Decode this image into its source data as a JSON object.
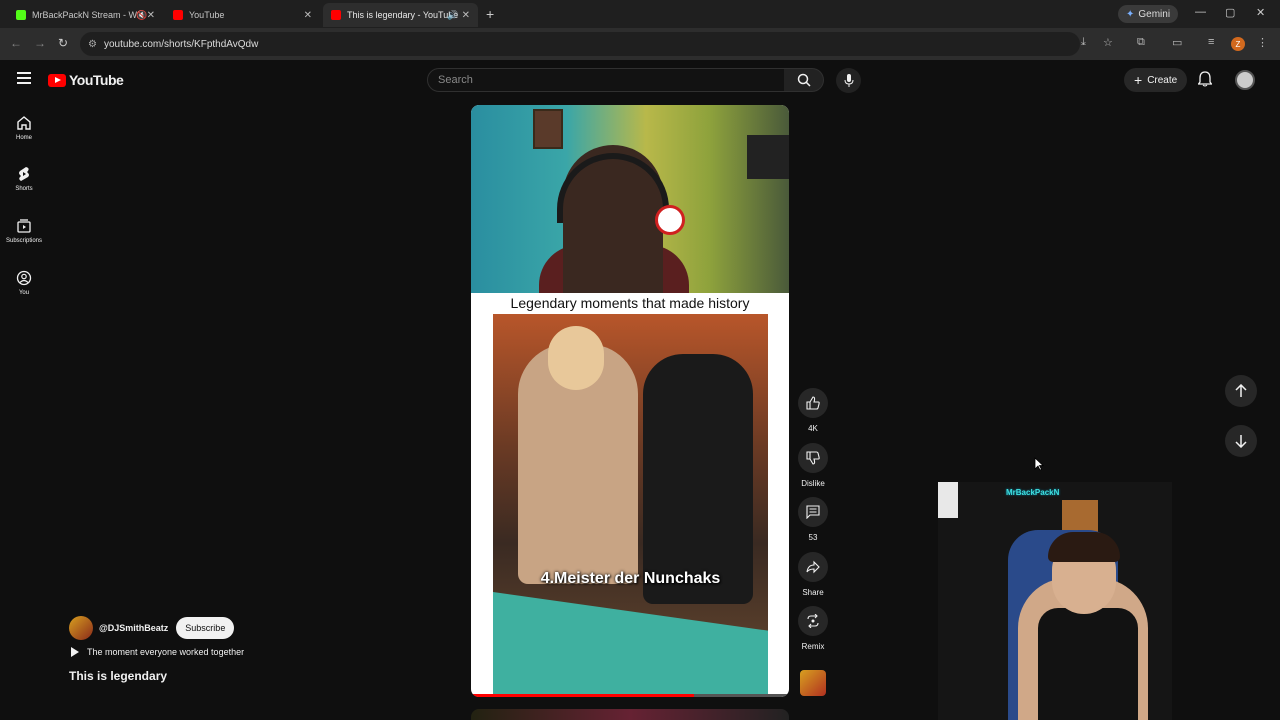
{
  "browser": {
    "tabs": [
      {
        "title": "MrBackPackN Stream - Wa",
        "favicon_color": "#53fc18"
      },
      {
        "title": "YouTube",
        "favicon_color": "#ff0000"
      },
      {
        "title": "This is legendary - YouTube",
        "favicon_color": "#ff0000",
        "active": true
      }
    ],
    "new_tab": "+",
    "gemini_label": "Gemini",
    "url": "youtube.com/shorts/KFpthdAvQdw",
    "profile_initial": "Z"
  },
  "header": {
    "logo_text": "YouTube",
    "search_placeholder": "Search",
    "create_label": "Create"
  },
  "sidebar": {
    "items": [
      {
        "label": "Home",
        "icon": "home-icon"
      },
      {
        "label": "Shorts",
        "icon": "shorts-icon"
      },
      {
        "label": "Subscriptions",
        "icon": "subscriptions-icon"
      },
      {
        "label": "You",
        "icon": "you-icon"
      }
    ]
  },
  "short": {
    "caption": "Legendary moments that made history",
    "subtitle": "4.Meister der Nunchaks",
    "progress": 0.7
  },
  "actions": {
    "like_count": "4K",
    "dislike_label": "Dislike",
    "comments_count": "53",
    "share_label": "Share",
    "remix_label": "Remix"
  },
  "channel": {
    "handle": "@DJSmithBeatz",
    "subscribe_label": "Subscribe",
    "description": "The moment everyone worked together",
    "title": "This is legendary"
  },
  "webcam": {
    "overlay_tag": "MrBackPackN"
  },
  "colors": {
    "accent": "#ff0000",
    "background": "#0f0f0f",
    "button_bg": "#272727"
  }
}
